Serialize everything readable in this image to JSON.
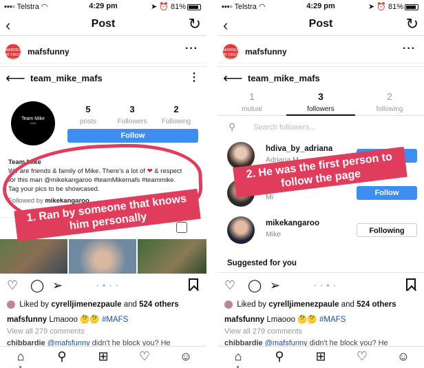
{
  "left": {
    "status": {
      "carrier": "Telstra",
      "time": "4:29 pm",
      "battery": "81%"
    },
    "nav": {
      "title": "Post"
    },
    "post_user": {
      "name": "mafsfunny",
      "avatar_text": "MARRIED AT FIRST SIGHT FUNNY"
    },
    "profile": {
      "username": "team_mike_mafs",
      "avatar_text": "Team Mike",
      "avatar_sub": "mafs",
      "stats": [
        {
          "num": "5",
          "label": "posts"
        },
        {
          "num": "3",
          "label": "Followers"
        },
        {
          "num": "2",
          "label": "Following"
        }
      ],
      "follow_label": "Follow",
      "bio_name": "Team Mike",
      "bio_line1": "We are friends & family of Mike. There's a lot of",
      "bio_line1b": "& respect",
      "bio_line2": "for this man @mikekangaroo #teamMikemafs #teammike.",
      "bio_line3": "Tag your pics to be showcased.",
      "followed_by_prefix": "Followed by",
      "followed_by_user": "mikekangaroo"
    },
    "annotation": "1. Ran by someone that knows him personally"
  },
  "right": {
    "status": {
      "carrier": "Telstra",
      "time": "4:29 pm",
      "battery": "81%"
    },
    "nav": {
      "title": "Post"
    },
    "post_user": {
      "name": "mafsfunny"
    },
    "profile": {
      "username": "team_mike_mafs"
    },
    "tabs": [
      {
        "num": "1",
        "label": "mutual"
      },
      {
        "num": "3",
        "label": "followers"
      },
      {
        "num": "2",
        "label": "following"
      }
    ],
    "search_placeholder": "Search followers...",
    "followers": [
      {
        "name": "hdiva_by_adriana",
        "sub": "Adriana M",
        "button": "Follow"
      },
      {
        "name": "",
        "sub": "Mi",
        "button": "Follow"
      },
      {
        "name": "mikekangaroo",
        "sub": "Mike",
        "button": "Following"
      }
    ],
    "suggested": "Suggested for you",
    "annotation": "2. He was the first person to follow the page"
  },
  "post": {
    "liked_by_prefix": "Liked by",
    "liked_by_user": "cyrelljimenezpaule",
    "liked_and": "and",
    "liked_others": "524 others",
    "caption_user": "mafsfunny",
    "caption_text": "Lmaooo 🤔🤔",
    "caption_hashtag": "#MAFS",
    "view_all": "View all 279 comments",
    "comment_user": "chibbardie",
    "comment_mention": "@mafsfunny",
    "comment_text": "didn't he block you? He"
  },
  "colors": {
    "accent": "#3d8ef0",
    "annotation": "#e03c5c",
    "hashtag": "#1b4fa0"
  }
}
